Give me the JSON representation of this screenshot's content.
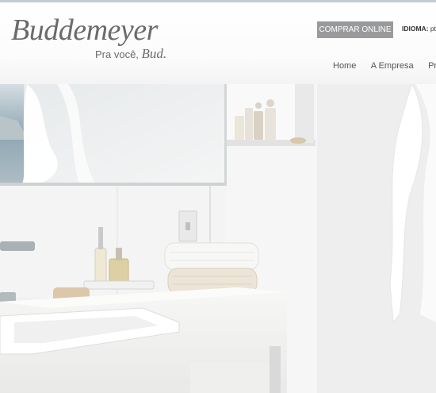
{
  "brand": {
    "name": "Buddemeyer",
    "tagline_prefix": "Pra você,",
    "tagline_bud": "Bud."
  },
  "header": {
    "buy_online": "COMPRAR ONLINE",
    "language_label": "IDIOMA:",
    "language_value": "pt"
  },
  "nav": {
    "items": [
      "Home",
      "A Empresa",
      "Prod"
    ]
  },
  "colors": {
    "topline": "#c3ccd3",
    "button": "#999a9c",
    "text": "#555555",
    "logo": "#6b6b6b"
  }
}
